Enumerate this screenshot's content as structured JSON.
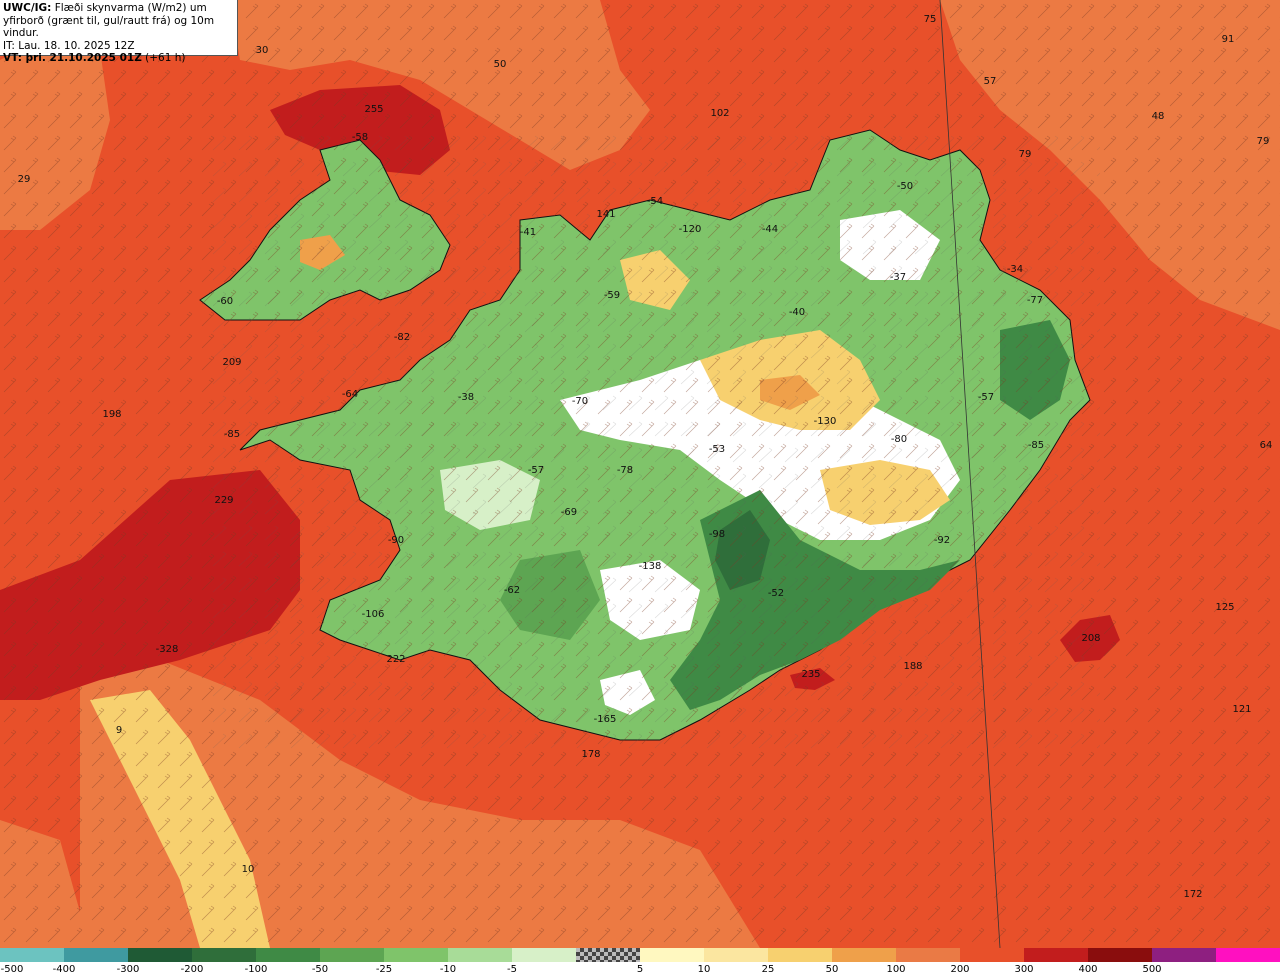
{
  "header": {
    "line1_prefix": "UWC/IG:",
    "line1_rest": " Flæði skynvarma (W/m2) um",
    "line2": "yfirborð (grænt til, gul/rautt frá) og 10m vindur.",
    "line3": "IT: Lau. 18. 10. 2025 12Z",
    "line4_prefix": "VT: þri. 21.10.2025 01Z",
    "line4_rest": " (+61 h)"
  },
  "colors": {
    "ocean": "#e8502a",
    "ocean_dark": "#c21d1d",
    "ocean_light": "#ec7a43",
    "land_green": "#7fc46a",
    "land_dark_green": "#3f8a45",
    "land_pale": "#d7f0c8",
    "land_white": "#ffffff",
    "land_yellow": "#f7d06f",
    "land_orange": "#efa04a"
  },
  "labels": [
    {
      "text": "30"
    },
    {
      "text": "50"
    },
    {
      "text": "75"
    },
    {
      "text": "91"
    },
    {
      "text": "57"
    },
    {
      "text": "48"
    },
    {
      "text": "79"
    },
    {
      "text": "79"
    },
    {
      "text": "29"
    },
    {
      "text": "255"
    },
    {
      "text": "102"
    },
    {
      "text": "-58"
    },
    {
      "text": "-50"
    },
    {
      "text": "141"
    },
    {
      "text": "-54"
    },
    {
      "text": "-120"
    },
    {
      "text": "-44"
    },
    {
      "text": "-41"
    },
    {
      "text": "-37"
    },
    {
      "text": "-34"
    },
    {
      "text": "-60"
    },
    {
      "text": "-59"
    },
    {
      "text": "-77"
    },
    {
      "text": "-40"
    },
    {
      "text": "-82"
    },
    {
      "text": "209"
    },
    {
      "text": "198"
    },
    {
      "text": "-70"
    },
    {
      "text": "-38"
    },
    {
      "text": "-64"
    },
    {
      "text": "-57"
    },
    {
      "text": "-85"
    },
    {
      "text": "-130"
    },
    {
      "text": "-80"
    },
    {
      "text": "-85"
    },
    {
      "text": "64"
    },
    {
      "text": "-53"
    },
    {
      "text": "-57"
    },
    {
      "text": "-78"
    },
    {
      "text": "229"
    },
    {
      "text": "-69"
    },
    {
      "text": "-98"
    },
    {
      "text": "-92"
    },
    {
      "text": "-90"
    },
    {
      "text": "-138"
    },
    {
      "text": "-62"
    },
    {
      "text": "-52"
    },
    {
      "text": "125"
    },
    {
      "text": "-106"
    },
    {
      "text": "208"
    },
    {
      "text": "-328"
    },
    {
      "text": "222"
    },
    {
      "text": "188"
    },
    {
      "text": "235"
    },
    {
      "text": "9"
    },
    {
      "text": "-165"
    },
    {
      "text": "121"
    },
    {
      "text": "178"
    },
    {
      "text": "10"
    },
    {
      "text": "172"
    }
  ],
  "colorbar": {
    "swatch_colors": [
      "#6cc3c0",
      "#3f9aa0",
      "#1f5a35",
      "#2f6e3a",
      "#3f8a45",
      "#5da552",
      "#7fc46a",
      "#a8dc98",
      "#d7f0c8",
      "checker",
      "#fff8c0",
      "#fbe6a0",
      "#f7d06f",
      "#efa04a",
      "#ea7a45",
      "#e8502a",
      "#c21d1d",
      "#8a0d0d",
      "#8e1f80",
      "#ff10c0"
    ],
    "ticks": [
      "-500",
      "-400",
      "-300",
      "-200",
      "-100",
      "-50",
      "-25",
      "-10",
      "-5",
      "5",
      "10",
      "25",
      "50",
      "100",
      "200",
      "300",
      "400",
      "500"
    ]
  }
}
